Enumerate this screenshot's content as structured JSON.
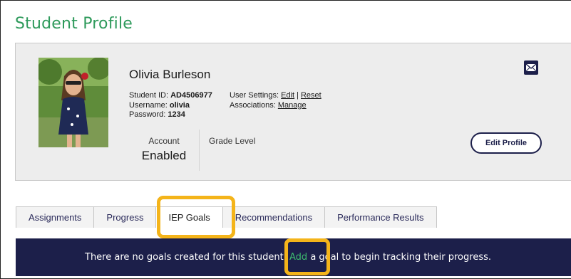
{
  "page": {
    "title": "Student Profile"
  },
  "profile": {
    "name": "Olivia Burleson",
    "student_id_label": "Student ID:",
    "student_id": "AD4506977",
    "username_label": "Username:",
    "username": "olivia",
    "password_label": "Password:",
    "password": "1234",
    "user_settings_label": "User Settings:",
    "edit_link": "Edit",
    "separator": "|",
    "reset_link": "Reset",
    "associations_label": "Associations:",
    "manage_link": "Manage",
    "account_label": "Account",
    "account_status": "Enabled",
    "grade_level_label": "Grade Level",
    "edit_profile_button": "Edit Profile",
    "mail_icon": "envelope-icon"
  },
  "tabs": [
    {
      "label": "Assignments",
      "active": false
    },
    {
      "label": "Progress",
      "active": false
    },
    {
      "label": "IEP Goals",
      "active": true
    },
    {
      "label": "Recommendations",
      "active": false
    },
    {
      "label": "Performance Results",
      "active": false
    }
  ],
  "banner": {
    "text_before": "There are no goals created for this student. ",
    "link_text": "Add",
    "text_after": " a goal to begin tracking their progress."
  },
  "colors": {
    "title_green": "#2e9a5b",
    "navy": "#1c1f4a",
    "highlight_orange": "#f4b41a",
    "link_green": "#3dbb6f",
    "card_gray": "#ededed"
  }
}
